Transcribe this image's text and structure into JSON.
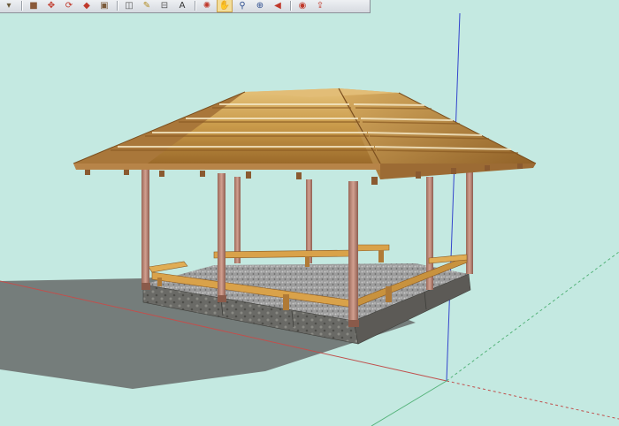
{
  "app": "SketchUp",
  "colors": {
    "background": "#c4e9e1",
    "red_axis": "#c0504d",
    "green_axis": "#55b37a",
    "blue_axis": "#3344cc",
    "thatch": "#c99a4a",
    "post": "#b88070",
    "bench": "#d9a24a",
    "gravel": "#9a9a9a",
    "base": "#6d6a66"
  },
  "toolbar": {
    "tools": [
      {
        "name": "paint-bucket-icon",
        "glyph": "▾",
        "color": "#6b5a3a"
      },
      {
        "name": "push-pull-icon",
        "glyph": "■",
        "color": "#8a5a3a"
      },
      {
        "name": "move-icon",
        "glyph": "✥",
        "color": "#c0392b"
      },
      {
        "name": "rotate-icon",
        "glyph": "⟳",
        "color": "#c0392b"
      },
      {
        "name": "follow-me-icon",
        "glyph": "◆",
        "color": "#c0392b"
      },
      {
        "name": "scale-icon",
        "glyph": "▣",
        "color": "#7a5a3a"
      },
      {
        "name": "offset-icon",
        "glyph": "◫",
        "color": "#555555"
      },
      {
        "name": "tape-measure-icon",
        "glyph": "✎",
        "color": "#b08a20"
      },
      {
        "name": "dimension-icon",
        "glyph": "⊟",
        "color": "#555555"
      },
      {
        "name": "text-icon",
        "glyph": "A",
        "color": "#333333"
      },
      {
        "name": "orbit-icon",
        "glyph": "✺",
        "color": "#c0392b"
      },
      {
        "name": "pan-icon",
        "glyph": "✋",
        "color": "#8a6a3a"
      },
      {
        "name": "zoom-icon",
        "glyph": "⚲",
        "color": "#2f4f8f"
      },
      {
        "name": "zoom-extents-icon",
        "glyph": "⊕",
        "color": "#2f4f8f"
      },
      {
        "name": "previous-view-icon",
        "glyph": "◀",
        "color": "#c0392b"
      },
      {
        "name": "get-models-icon",
        "glyph": "◉",
        "color": "#c0392b"
      },
      {
        "name": "share-model-icon",
        "glyph": "⇪",
        "color": "#c0392b"
      }
    ]
  },
  "scene": {
    "model": "thatched-roof-gazebo",
    "post_count": 9,
    "bench_count": 4
  }
}
